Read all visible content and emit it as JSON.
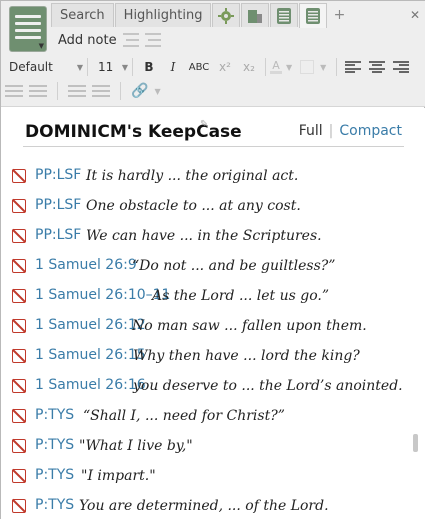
{
  "tabs": [
    {
      "label": "Search"
    },
    {
      "label": "Highlighting"
    }
  ],
  "toolbar": {
    "add_note_label": "Add note",
    "style_value": "Default",
    "size_value": "11",
    "bold_label": "B",
    "italic_label": "I",
    "smallcaps_label": "ABC",
    "superscript_label": "x²",
    "subscript_label": "x₂",
    "font_color_label": "A"
  },
  "page": {
    "title": "DOMINICM's KeepCase",
    "view_full": "Full",
    "view_compact": "Compact"
  },
  "notes": [
    {
      "ref": "PP:LSF",
      "text": "It is hardly ... the original act."
    },
    {
      "ref": "PP:LSF",
      "text": "One obstacle to ... at any cost."
    },
    {
      "ref": "PP:LSF",
      "text": "We can have ... in the Scriptures."
    },
    {
      "ref": "1 Samuel 26:9",
      "text": "“Do not ... and be guiltless?”"
    },
    {
      "ref": "1 Samuel 26:10–11",
      "text": "As the Lord ... let us go.”"
    },
    {
      "ref": "1 Samuel 26:12",
      "text": "No man saw ... fallen upon them."
    },
    {
      "ref": "1 Samuel 26:15",
      "text": "Why then have ... lord the king?"
    },
    {
      "ref": "1 Samuel 26:16",
      "text": "you deserve to ... the Lord’s anointed."
    },
    {
      "ref": "P:TYS",
      "text": "“Shall I, ... need for Christ?”"
    },
    {
      "ref": "P:TYS",
      "text": "\"What I live by,\""
    },
    {
      "ref": "P:TYS",
      "text": "\"I impart.\""
    },
    {
      "ref": "P:TYS",
      "text": "You are determined, ... of the Lord."
    }
  ]
}
